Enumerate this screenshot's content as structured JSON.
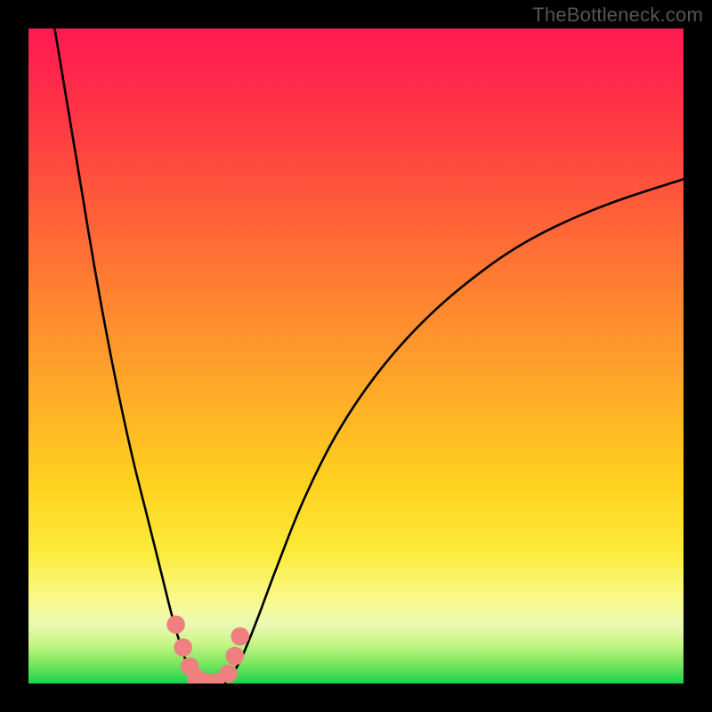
{
  "watermark": "TheBottleneck.com",
  "colors": {
    "frame": "#000000",
    "gradient_top": "#ff1a52",
    "gradient_mid": "#ffd31f",
    "gradient_bottom": "#17d34c",
    "curve": "#000000",
    "marker_fill": "#f08080",
    "marker_stroke": "#e55a5a"
  },
  "chart_data": {
    "type": "line",
    "title": "",
    "xlabel": "",
    "ylabel": "",
    "xlim": [
      0,
      100
    ],
    "ylim": [
      0,
      100
    ],
    "grid": false,
    "legend": null,
    "series": [
      {
        "name": "curve-left",
        "x": [
          4,
          6,
          8,
          10,
          12,
          14,
          16,
          18,
          20,
          22,
          23.5,
          25,
          26
        ],
        "y": [
          100,
          88,
          76,
          64,
          53,
          43,
          34,
          26,
          18,
          10,
          5,
          1,
          0
        ]
      },
      {
        "name": "curve-right",
        "x": [
          30,
          31.5,
          33,
          35,
          38,
          42,
          47,
          53,
          60,
          68,
          77,
          88,
          100
        ],
        "y": [
          0,
          2,
          5,
          10,
          18,
          28,
          38,
          47,
          55,
          62,
          68,
          73,
          77
        ]
      }
    ],
    "annotations": [
      {
        "type": "flat-bottom",
        "x_range": [
          26,
          30
        ],
        "y": 0
      }
    ],
    "markers": {
      "name": "highlight-points",
      "color": "#f08080",
      "radius_pct": 1.4,
      "points": [
        {
          "x": 22.5,
          "y": 9
        },
        {
          "x": 23.6,
          "y": 5.5
        },
        {
          "x": 24.6,
          "y": 2.6
        },
        {
          "x": 25.6,
          "y": 0.9
        },
        {
          "x": 27.0,
          "y": 0.2
        },
        {
          "x": 28.5,
          "y": 0.2
        },
        {
          "x": 30.5,
          "y": 1.5
        },
        {
          "x": 31.5,
          "y": 4.2
        },
        {
          "x": 32.3,
          "y": 7.2
        }
      ]
    }
  }
}
